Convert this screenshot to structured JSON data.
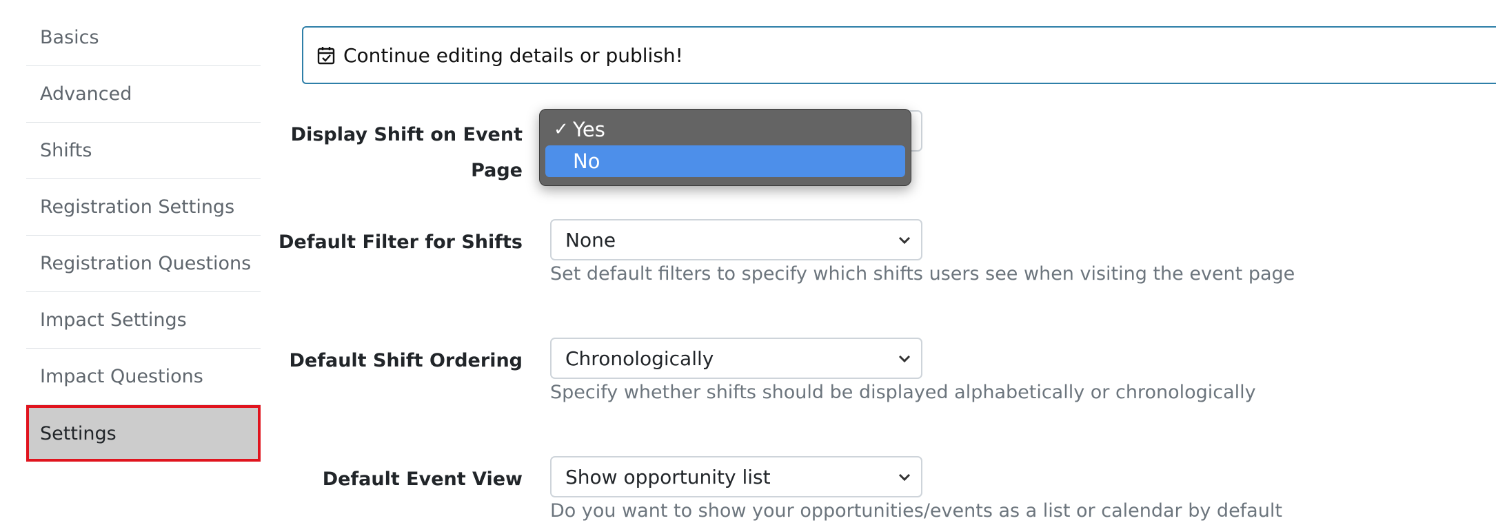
{
  "sidebar": {
    "items": [
      {
        "label": "Basics"
      },
      {
        "label": "Advanced"
      },
      {
        "label": "Shifts"
      },
      {
        "label": "Registration Settings"
      },
      {
        "label": "Registration Questions"
      },
      {
        "label": "Impact Settings"
      },
      {
        "label": "Impact Questions"
      },
      {
        "label": "Settings"
      }
    ]
  },
  "alert": {
    "icon": "calendar-check-icon",
    "text": "Continue editing details or publish!"
  },
  "form": {
    "display_shift": {
      "label_line1": "Display Shift on Event",
      "label_line2": "Page",
      "options": [
        "Yes",
        "No"
      ],
      "selected": "Yes",
      "highlighted": "No"
    },
    "default_filter": {
      "label": "Default Filter for Shifts",
      "value": "None",
      "help": "Set default filters to specify which shifts users see when visiting the event page"
    },
    "default_ordering": {
      "label": "Default Shift Ordering",
      "value": "Chronologically",
      "help": "Specify whether shifts should be displayed alphabetically or chronologically"
    },
    "default_view": {
      "label": "Default Event View",
      "value": "Show opportunity list",
      "help": "Do you want to show your opportunities/events as a list or calendar by default"
    }
  },
  "colors": {
    "active_outline": "#e0141e",
    "alert_border": "#2e7fa8",
    "dropdown_highlight": "#4d8fea"
  }
}
